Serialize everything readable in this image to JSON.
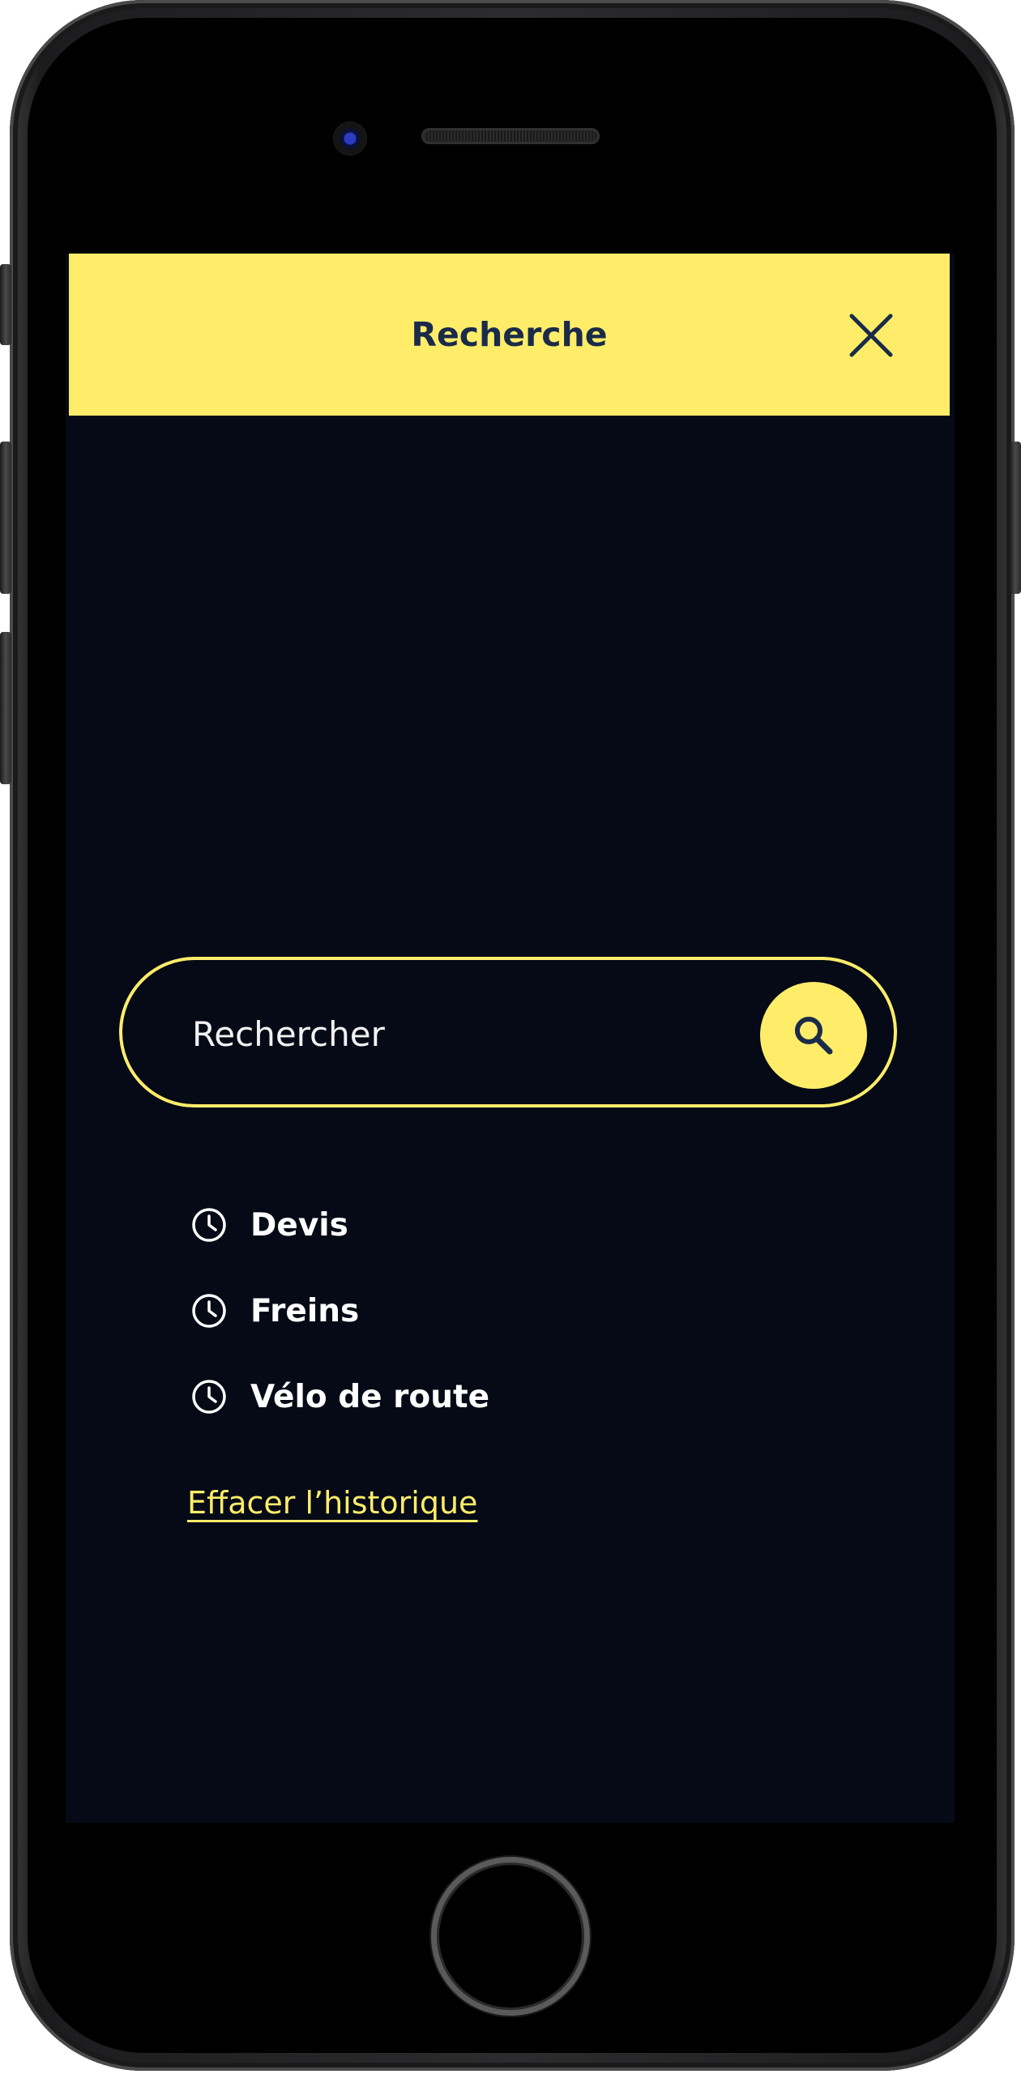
{
  "header": {
    "title": "Recherche",
    "close_icon": "close-icon"
  },
  "search": {
    "placeholder": "Rechercher",
    "value": "",
    "button_icon": "search-icon"
  },
  "history": {
    "items": [
      {
        "label": "Devis",
        "icon": "clock-icon"
      },
      {
        "label": "Freins",
        "icon": "clock-icon"
      },
      {
        "label": "Vélo de route",
        "icon": "clock-icon"
      }
    ],
    "clear_label": "Effacer l’historique"
  },
  "colors": {
    "accent": "#ffed69",
    "background": "#050a16",
    "header_text": "#1a2b4a",
    "text": "#ffffff"
  }
}
